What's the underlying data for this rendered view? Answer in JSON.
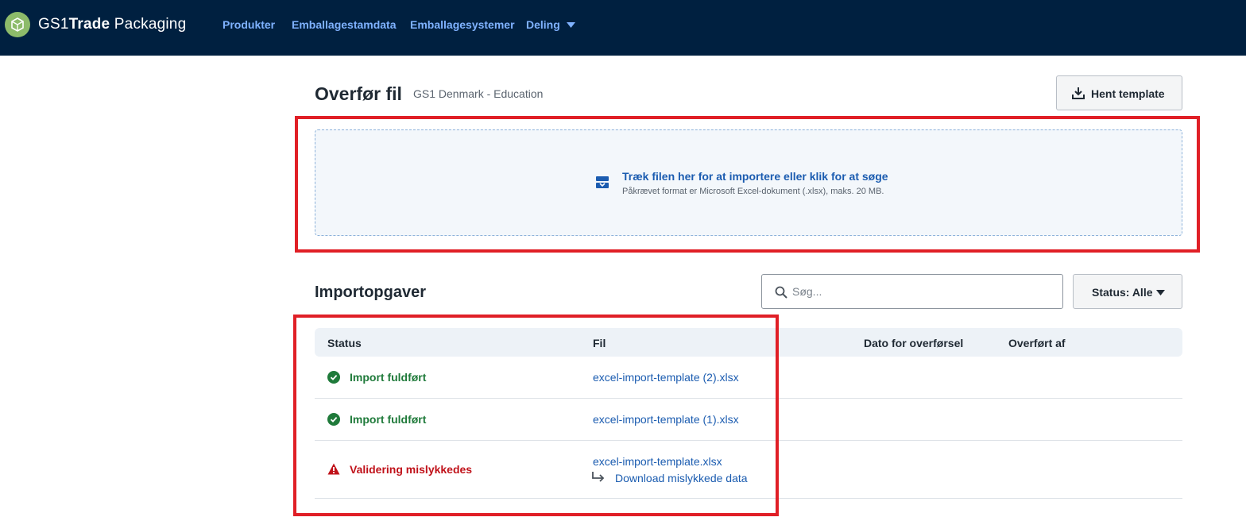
{
  "header": {
    "brand": {
      "part1": "GS1",
      "part2": "Trade",
      "part3": " Packaging"
    },
    "nav": [
      {
        "label": "Produkter"
      },
      {
        "label": "Emballagestamdata"
      },
      {
        "label": "Emballagesystemer"
      },
      {
        "label": "Deling",
        "has_dropdown": true
      }
    ]
  },
  "upload": {
    "title": "Overfør fil",
    "organization": "GS1 Denmark - Education",
    "template_button": "Hent template",
    "dropzone": {
      "main_text": "Træk filen her for at importere eller klik for at søge",
      "sub_text": "Påkrævet format er Microsoft Excel-dokument (.xlsx), maks. 20 MB."
    }
  },
  "imports": {
    "title": "Importopgaver",
    "search_placeholder": "Søg...",
    "status_filter": "Status: Alle",
    "columns": [
      "Status",
      "Fil",
      "Dato for overførsel",
      "Overført af"
    ],
    "rows": [
      {
        "status": "Import fuldført",
        "status_type": "success",
        "file": "excel-import-template (2).xlsx",
        "date": "",
        "by": ""
      },
      {
        "status": "Import fuldført",
        "status_type": "success",
        "file": "excel-import-template (1).xlsx",
        "date": "",
        "by": ""
      },
      {
        "status": "Validering mislykkedes",
        "status_type": "error",
        "file": "excel-import-template.xlsx",
        "download_link": "Download mislykkede data",
        "date": "",
        "by": ""
      }
    ]
  },
  "colors": {
    "header_bg": "#002040",
    "nav_link": "#7fb2ff",
    "link": "#1b5cb0",
    "success": "#1f7a3a",
    "error": "#c0121a",
    "highlight": "#e01f26"
  },
  "icons": [
    "logo-icon",
    "chevron-down-icon",
    "download-icon",
    "upload-tray-icon",
    "search-icon",
    "check-circle-icon",
    "warning-icon",
    "return-arrow-icon"
  ]
}
